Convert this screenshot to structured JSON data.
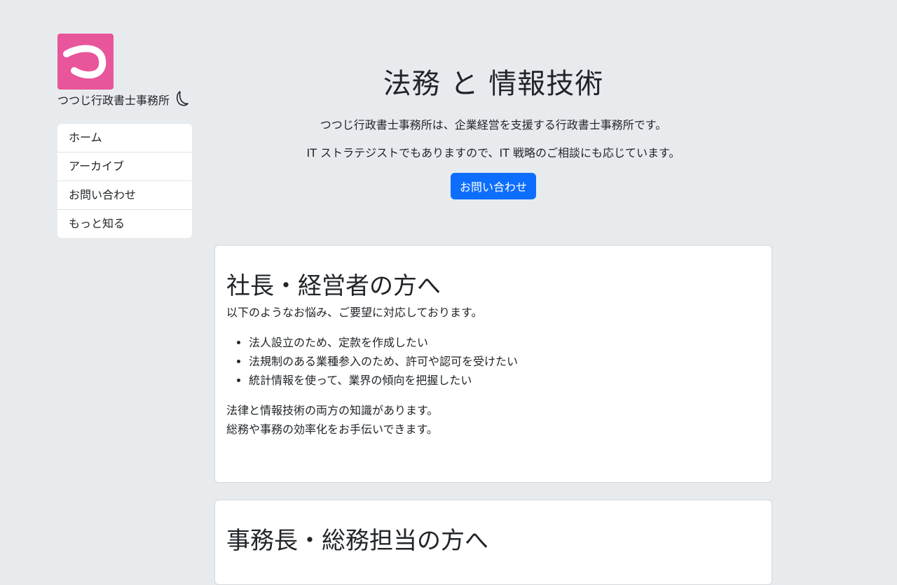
{
  "brand": {
    "logo_char": "つ",
    "logo_color": "#e8559a",
    "name": "つつじ行政書士事務所",
    "theme_icon": "moon-icon"
  },
  "nav": {
    "items": [
      {
        "label": "ホーム"
      },
      {
        "label": "アーカイブ"
      },
      {
        "label": "お問い合わせ"
      },
      {
        "label": "もっと知る"
      }
    ]
  },
  "hero": {
    "title": "法務 と 情報技術",
    "line1": "つつじ行政書士事務所は、企業経営を支援する行政書士事務所です。",
    "line2": "IT ストラテジストでもありますので、IT 戦略のご相談にも応じています。",
    "button": "お問い合わせ",
    "button_color": "#0d6efd"
  },
  "sections": [
    {
      "heading": "社長・経営者の方へ",
      "intro": "以下のようなお悩み、ご要望に対応しております。",
      "items": [
        "法人設立のため、定款を作成したい",
        "法規制のある業種参入のため、許可や認可を受けたい",
        "統計情報を使って、業界の傾向を把握したい"
      ],
      "outro1": "法律と情報技術の両方の知識があります。",
      "outro2": "総務や事務の効率化をお手伝いできます。"
    },
    {
      "heading": "事務長・総務担当の方へ"
    }
  ],
  "colors": {
    "background": "#e8ebee",
    "text": "#212529"
  }
}
